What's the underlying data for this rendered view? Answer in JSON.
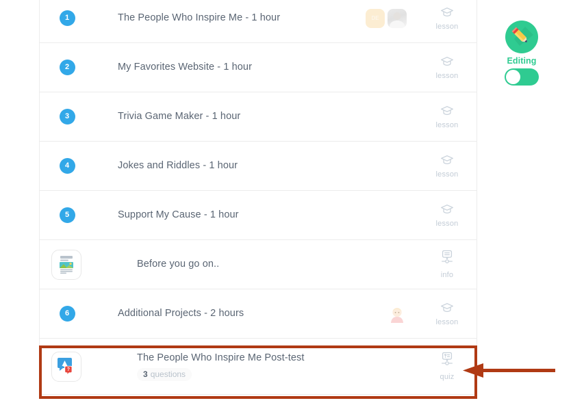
{
  "course_list": {
    "rows": [
      {
        "kind": "numbered",
        "number": "1",
        "title": "The People Who Inspire Me - 1 hour",
        "type_label": "lesson",
        "type_icon": "graduation-cap-icon",
        "avatars": [
          {
            "style": "initials",
            "text": "DE"
          },
          {
            "style": "photo",
            "text": ""
          }
        ]
      },
      {
        "kind": "numbered",
        "number": "2",
        "title": "My Favorites Website - 1 hour",
        "type_label": "lesson",
        "type_icon": "graduation-cap-icon",
        "avatars": []
      },
      {
        "kind": "numbered",
        "number": "3",
        "title": "Trivia Game Maker - 1 hour",
        "type_label": "lesson",
        "type_icon": "graduation-cap-icon",
        "avatars": []
      },
      {
        "kind": "numbered",
        "number": "4",
        "title": "Jokes and Riddles - 1 hour",
        "type_label": "lesson",
        "type_icon": "graduation-cap-icon",
        "avatars": []
      },
      {
        "kind": "numbered",
        "number": "5",
        "title": "Support My Cause - 1 hour",
        "type_label": "lesson",
        "type_icon": "graduation-cap-icon",
        "avatars": []
      },
      {
        "kind": "tile",
        "tile_icon": "document-image-icon",
        "title": "Before you go on..",
        "type_label": "info",
        "type_icon": "info-bubble-icon",
        "avatars": []
      },
      {
        "kind": "numbered",
        "number": "6",
        "title": "Additional Projects - 2 hours",
        "type_label": "lesson",
        "type_icon": "graduation-cap-icon",
        "avatars": [
          {
            "style": "kid",
            "text": ""
          }
        ]
      },
      {
        "kind": "tile",
        "tile_icon": "quiz-bubbles-icon",
        "title": "The People Who Inspire Me Post-test",
        "question_count": "3",
        "question_label": "questions",
        "type_label": "quiz",
        "type_icon": "quiz-bubble-icon",
        "avatars": [],
        "highlighted": true
      }
    ]
  },
  "editing_panel": {
    "icon": "pencil-icon",
    "label": "Editing",
    "toggle_state": "off"
  },
  "annotation": {
    "arrow": "left-arrow-annotation",
    "highlight_color": "#b03a14"
  },
  "colors": {
    "number_badge": "#32a8e8",
    "accent_green": "#2fcb91",
    "title_text": "#5a6573",
    "muted_text": "#c3ccd6",
    "row_border": "#ececec"
  }
}
